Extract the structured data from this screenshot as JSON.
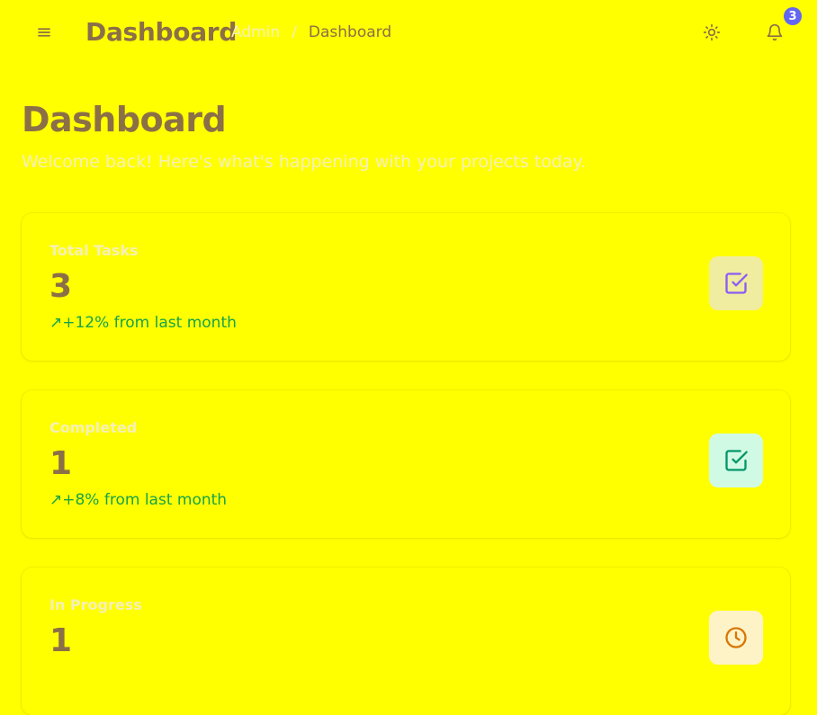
{
  "header": {
    "menu_icon": "hamburger-menu-icon",
    "title": "Dashboard",
    "breadcrumb": {
      "parent": "Admin",
      "separator": "/",
      "current": "Dashboard"
    },
    "theme_icon": "sun-icon",
    "notifications_icon": "bell-icon",
    "notification_count": "3"
  },
  "page": {
    "title": "Dashboard",
    "subtitle": "Welcome back! Here's what's happening with your projects today."
  },
  "stats": [
    {
      "label": "Total Tasks",
      "value": "3",
      "trend": "↗+12% from last month",
      "icon": "checkbox-check-icon",
      "icon_color": "#8b5cf6",
      "icon_bg": "#f0eca0"
    },
    {
      "label": "Completed",
      "value": "1",
      "trend": "↗+8% from last month",
      "icon": "checkbox-check-icon",
      "icon_color": "#059669",
      "icon_bg": "#d1fae5"
    },
    {
      "label": "In Progress",
      "value": "1",
      "trend": "",
      "icon": "clock-icon",
      "icon_color": "#d97706",
      "icon_bg": "#fef3c7"
    }
  ],
  "colors": {
    "background": "#ffff00",
    "text_primary": "#8b6f47",
    "text_muted": "#f5f0b8",
    "trend_positive": "#16a34a",
    "badge": "#6366f1"
  }
}
